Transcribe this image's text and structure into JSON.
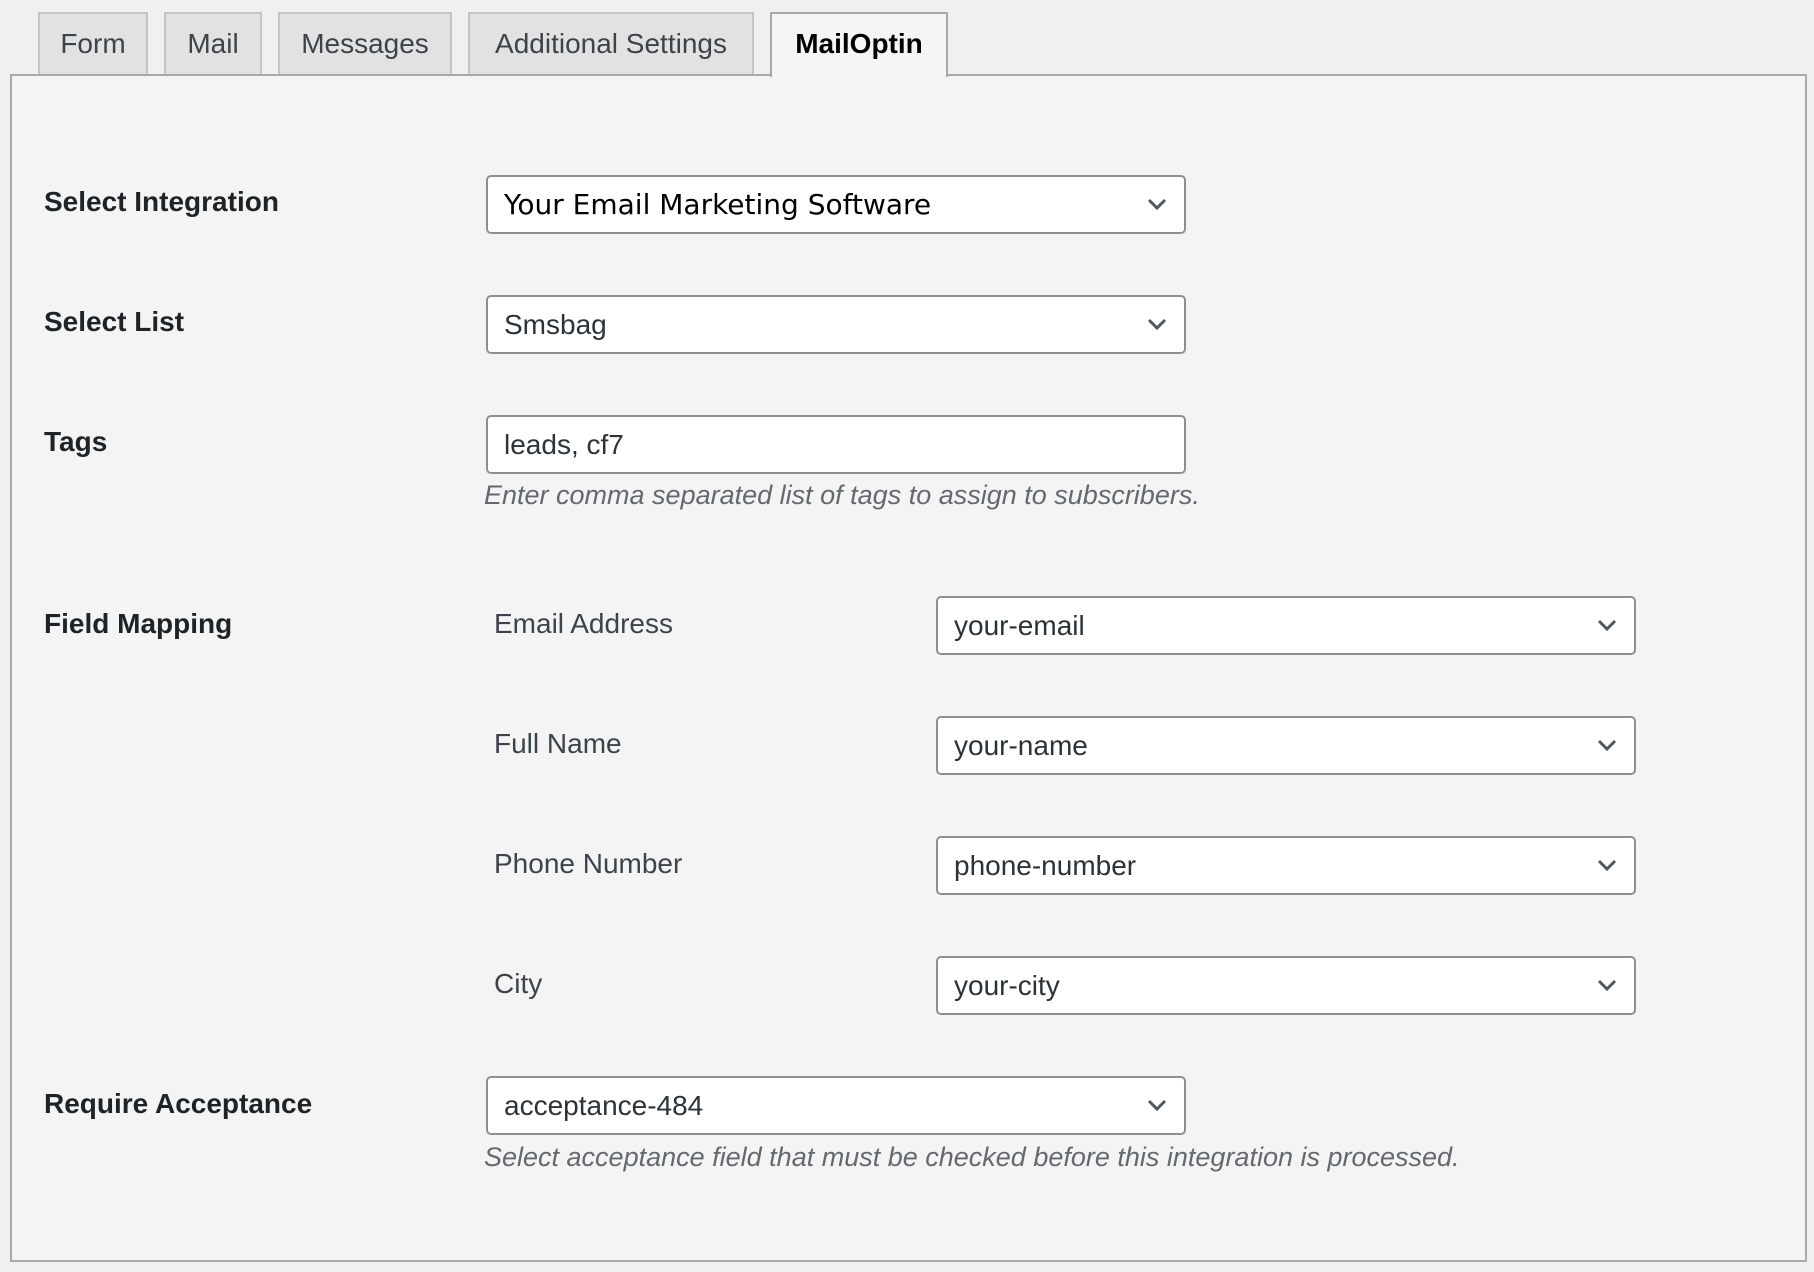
{
  "tabs": [
    {
      "label": "Form",
      "active": false
    },
    {
      "label": "Mail",
      "active": false
    },
    {
      "label": "Messages",
      "active": false
    },
    {
      "label": "Additional Settings",
      "active": false
    },
    {
      "label": "MailOptin",
      "active": true
    }
  ],
  "settings": {
    "integration": {
      "label": "Select Integration",
      "selected": "Your Email Marketing Software"
    },
    "list": {
      "label": "Select List",
      "selected": "Smsbag"
    },
    "tags": {
      "label": "Tags",
      "value": "leads, cf7",
      "help": "Enter comma separated list of tags to assign to subscribers."
    },
    "field_mapping": {
      "label": "Field Mapping",
      "rows": [
        {
          "field": "Email Address",
          "selected": "your-email"
        },
        {
          "field": "Full Name",
          "selected": "your-name"
        },
        {
          "field": "Phone Number",
          "selected": "phone-number"
        },
        {
          "field": "City",
          "selected": "your-city"
        }
      ]
    },
    "acceptance": {
      "label": "Require Acceptance",
      "selected": "acceptance-484",
      "help": "Select acceptance field that must be checked before this integration is processed."
    }
  },
  "icons": {
    "dropdown": "chevron-down-icon"
  },
  "colors": {
    "panel_bg": "#f4f4f4",
    "tab_bg": "#e2e2e2",
    "border": "#8c8f94",
    "help_text": "#646970"
  }
}
